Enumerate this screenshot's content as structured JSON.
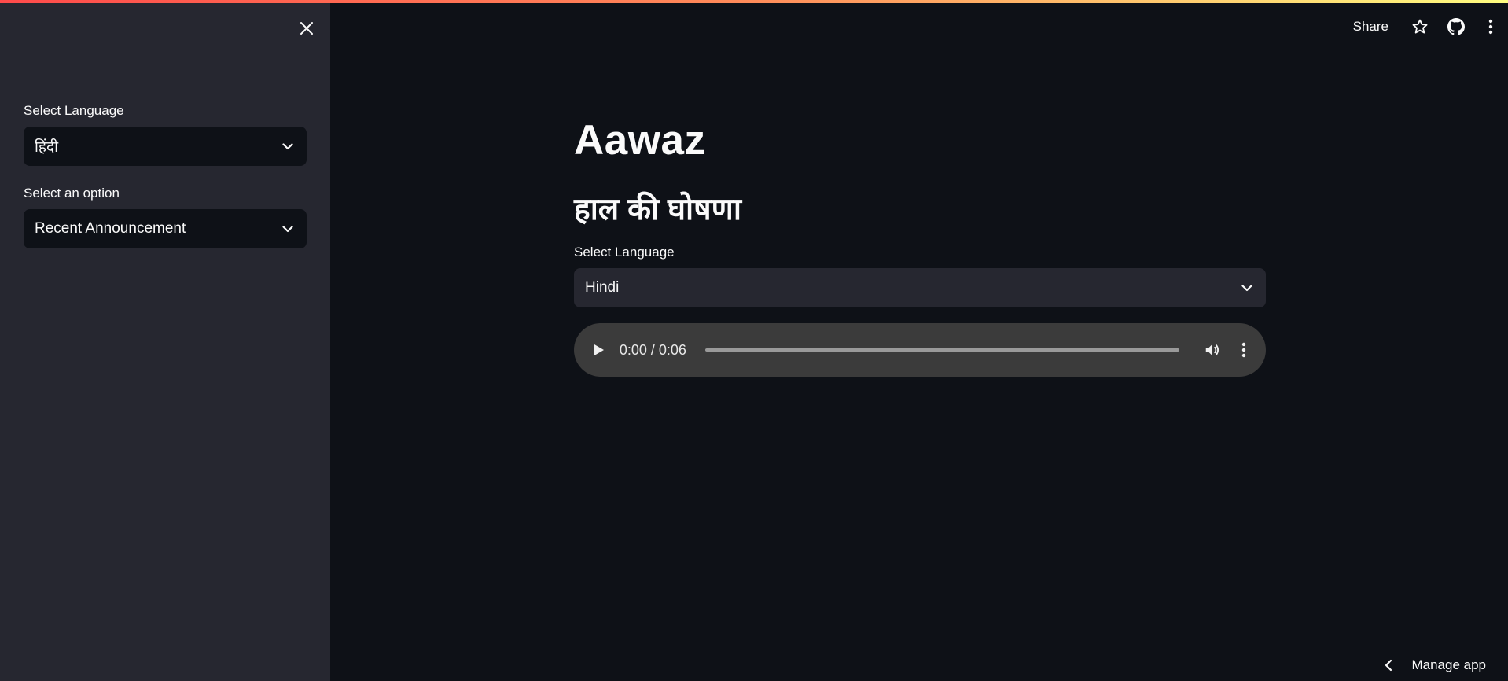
{
  "sidebar": {
    "language_label": "Select Language",
    "language_value": "हिंदी",
    "option_label": "Select an option",
    "option_value": "Recent Announcement"
  },
  "header": {
    "share_label": "Share"
  },
  "main": {
    "title": "Aawaz",
    "subtitle": "हाल की घोषणा",
    "language_label": "Select Language",
    "language_value": "Hindi"
  },
  "audio": {
    "time": "0:00 / 0:06",
    "progress": 0
  },
  "footer": {
    "manage_app_label": "Manage app"
  },
  "colors": {
    "background": "#0e1117",
    "sidebar": "#262730",
    "accent": "#ff4b4b",
    "audio_player": "#3b3b3b"
  }
}
